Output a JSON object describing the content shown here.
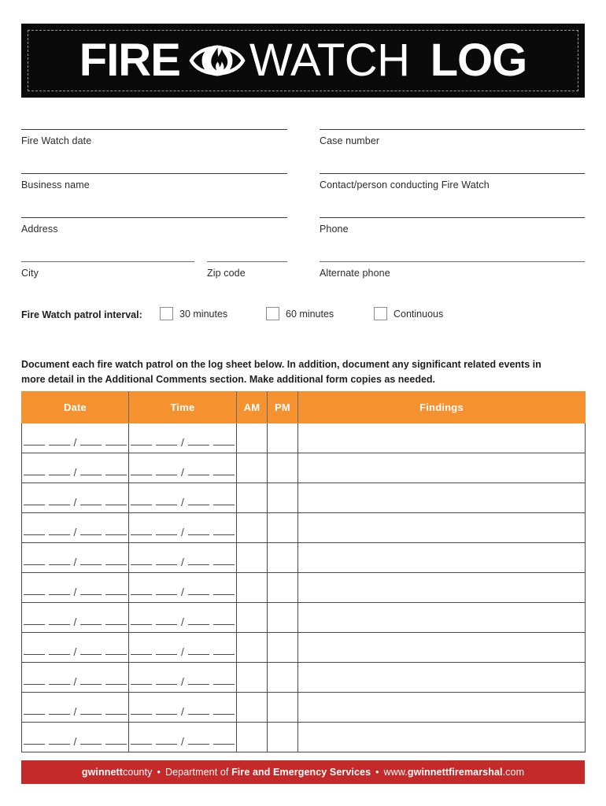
{
  "banner": {
    "word_fire": "FIRE",
    "logo_icon": "eye-flame-icon",
    "word_watch": "WATCH",
    "word_log": "LOG"
  },
  "form": {
    "left_fields": [
      {
        "label": "Fire Watch date",
        "value": ""
      },
      {
        "label": "Business name",
        "value": ""
      },
      {
        "label": "Address",
        "value": ""
      },
      {
        "label": "City",
        "value": ""
      }
    ],
    "zip_field": {
      "label": "Zip code",
      "value": ""
    },
    "right_fields": [
      {
        "label": "Case number",
        "value": ""
      },
      {
        "label": "Contact/person conducting Fire Watch",
        "value": ""
      },
      {
        "label": "Phone",
        "value": ""
      },
      {
        "label": "Alternate phone",
        "value": ""
      }
    ]
  },
  "interval": {
    "title": "Fire Watch patrol interval:",
    "options": [
      {
        "label": "30 minutes",
        "checked": false
      },
      {
        "label": "60 minutes",
        "checked": false
      },
      {
        "label": "Continuous",
        "checked": false
      }
    ]
  },
  "instructions": "Document each fire watch patrol on the log sheet below. In addition, document any significant related events in more detail in the Additional Comments section. Make additional form copies as needed.",
  "table": {
    "columns": [
      "Date",
      "Time",
      "AM",
      "PM",
      "Findings"
    ],
    "row_count": 11,
    "blank_cell_pattern": "__ __ / __ __",
    "rows": [
      {
        "date": "",
        "time": "",
        "am": "",
        "pm": "",
        "findings": ""
      },
      {
        "date": "",
        "time": "",
        "am": "",
        "pm": "",
        "findings": ""
      },
      {
        "date": "",
        "time": "",
        "am": "",
        "pm": "",
        "findings": ""
      },
      {
        "date": "",
        "time": "",
        "am": "",
        "pm": "",
        "findings": ""
      },
      {
        "date": "",
        "time": "",
        "am": "",
        "pm": "",
        "findings": ""
      },
      {
        "date": "",
        "time": "",
        "am": "",
        "pm": "",
        "findings": ""
      },
      {
        "date": "",
        "time": "",
        "am": "",
        "pm": "",
        "findings": ""
      },
      {
        "date": "",
        "time": "",
        "am": "",
        "pm": "",
        "findings": ""
      },
      {
        "date": "",
        "time": "",
        "am": "",
        "pm": "",
        "findings": ""
      },
      {
        "date": "",
        "time": "",
        "am": "",
        "pm": "",
        "findings": ""
      },
      {
        "date": "",
        "time": "",
        "am": "",
        "pm": "",
        "findings": ""
      }
    ]
  },
  "footer": {
    "org_bold": "gwinnett",
    "org_light": "county",
    "sep1": "•",
    "dept_prefix": "Department of ",
    "dept_bold": "Fire and Emergency Services",
    "sep2": "•",
    "url_prefix": "www.",
    "url_bold": "gwinnettfiremarshal",
    "url_suffix": ".com"
  },
  "colors": {
    "header_orange": "#F6912F",
    "footer_red": "#C42A2A",
    "banner_black": "#0A0A0A",
    "text": "#231F20"
  }
}
